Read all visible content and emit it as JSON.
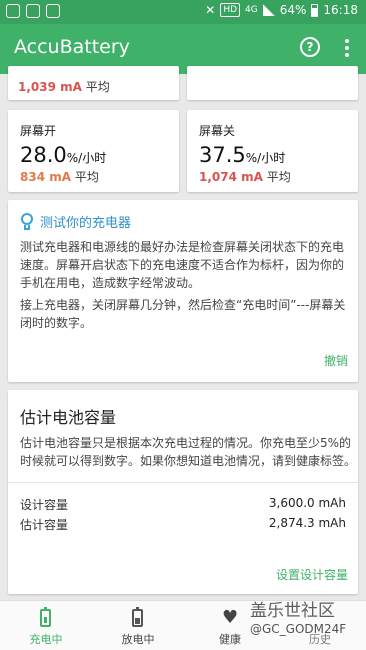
{
  "statusbar": {
    "hd": "HD",
    "network": "4G",
    "battery_pct": "64%",
    "time": "16:18"
  },
  "app": {
    "title": "AccuBattery"
  },
  "top_partial": {
    "value": "1,039 mA",
    "label": "平均"
  },
  "screen_on": {
    "label": "屏幕开",
    "value": "28.0",
    "unit": "%/小时",
    "avg_value": "834 mA",
    "avg_label": "平均"
  },
  "screen_off": {
    "label": "屏幕关",
    "value": "37.5",
    "unit": "%/小时",
    "avg_value": "1,074 mA",
    "avg_label": "平均"
  },
  "tip": {
    "title": "测试你的充电器",
    "para1": "测试充电器和电源线的最好办法是检查屏幕关闭状态下的充电速度。屏幕开启状态下的充电速度不适合作为标杆，因为你的手机在用电，造成数字经常波动。",
    "para2": "接上充电器，关闭屏幕几分钟，然后检查“充电时间”---屏幕关闭时的数字。",
    "dismiss": "撤销"
  },
  "capacity": {
    "title": "估计电池容量",
    "desc": "估计电池容量只是根据本次充电过程的情况。你充电至少5%的时候就可以得到数字。如果你想知道电池情况，请到健康标签。",
    "design_label": "设计容量",
    "design_value": "3,600.0 mAh",
    "estimated_label": "估计容量",
    "estimated_value": "2,874.3 mAh",
    "set_design": "设置设计容量"
  },
  "nav": {
    "charging": "充电中",
    "discharging": "放电中",
    "health": "健康",
    "history": "历史"
  },
  "watermark": {
    "line1": "盖乐世社区",
    "line2": "@GC_GODM24F"
  },
  "colors": {
    "primary": "#3fb168",
    "status": "#38a35e",
    "accent_blue": "#2f8fc8",
    "orange": "#e07a4a",
    "red": "#d9534f"
  }
}
